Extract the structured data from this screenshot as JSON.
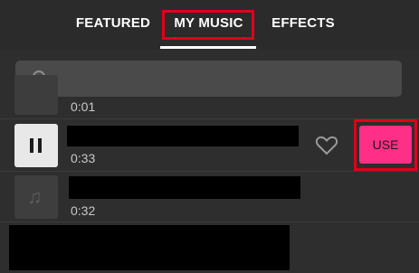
{
  "tabs": {
    "featured": "FEATURED",
    "my_music": "MY MUSIC",
    "effects": "EFFECTS"
  },
  "search": {
    "placeholder": ""
  },
  "tracks": [
    {
      "duration": "0:01"
    },
    {
      "duration": "0:33",
      "state": "playing"
    },
    {
      "duration": "0:32"
    }
  ],
  "actions": {
    "use_label": "USE"
  },
  "colors": {
    "background": "#2e2e2e",
    "accent": "#ff2e86",
    "highlight": "#e0001b"
  }
}
